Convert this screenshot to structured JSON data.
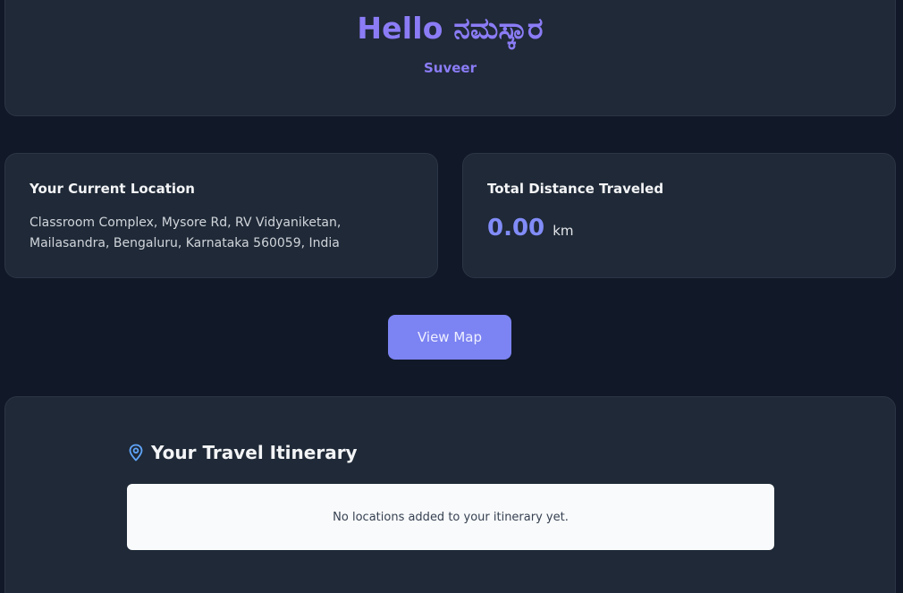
{
  "greeting": {
    "title": "Hello ನಮಸ್ಕಾರ",
    "name": "Suveer"
  },
  "location_card": {
    "heading": "Your Current Location",
    "address": "Classroom Complex, Mysore Rd, RV Vidyaniketan, Mailasandra, Bengaluru, Karnataka 560059, India"
  },
  "distance_card": {
    "heading": "Total Distance Traveled",
    "value": "0.00",
    "unit": "km"
  },
  "actions": {
    "view_map_label": "View Map"
  },
  "itinerary": {
    "icon": "map-pin-icon",
    "title": "Your Travel Itinerary",
    "empty_message": "No locations added to your itinerary yet."
  },
  "colors": {
    "background": "#111827",
    "card": "#1f2937",
    "accent": "#818cf8",
    "button": "#7c83f2"
  }
}
